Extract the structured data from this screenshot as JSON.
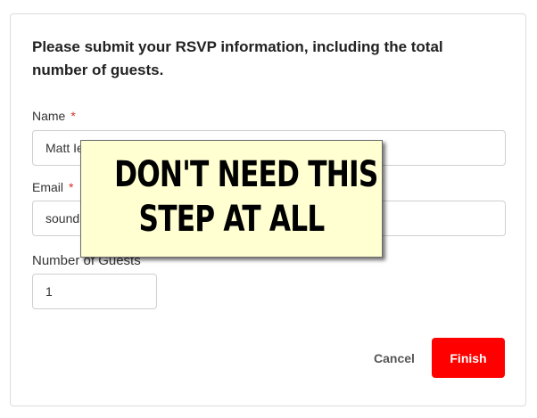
{
  "form": {
    "heading": "Please submit your RSVP information, including the total number of guests.",
    "required_marker": "*",
    "name": {
      "label": "Name",
      "value": "Matt Ie"
    },
    "email": {
      "label": "Email",
      "value": "sound"
    },
    "guests": {
      "label": "Number of Guests",
      "value": "1"
    },
    "cancel_label": "Cancel",
    "finish_label": "Finish"
  },
  "overlay": {
    "line1": "DON'T NEED THIS",
    "line2": "STEP AT ALL"
  },
  "colors": {
    "finish_button": "#ff0000",
    "required_marker": "#d93025",
    "sticky_note": "#ffffd2"
  }
}
